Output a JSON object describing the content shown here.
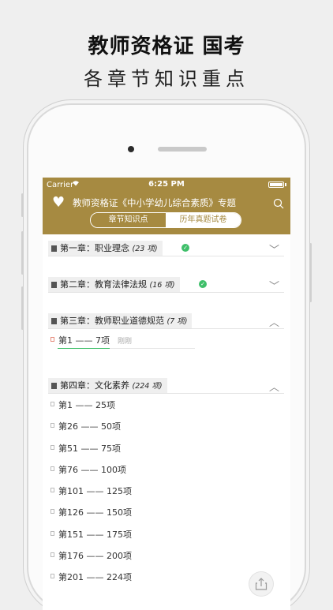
{
  "promo": {
    "title": "教师资格证 国考",
    "subtitle": "各章节知识重点"
  },
  "status": {
    "carrier": "Carrier",
    "time": "6:25 PM"
  },
  "header": {
    "title": "教师资格证《中小学幼儿综合素质》专题",
    "tabs": [
      {
        "label": "章节知识点",
        "active": true
      },
      {
        "label": "历年真题试卷",
        "active": false
      }
    ]
  },
  "chapters": [
    {
      "name": "第一章：职业理念",
      "count": "(23 项)",
      "completed": true,
      "expanded": false
    },
    {
      "name": "第二章：教育法律法规",
      "count": "(16 项)",
      "completed": true,
      "expanded": false
    },
    {
      "name": "第三章：教师职业道德规范",
      "count": "(7 项)",
      "completed": false,
      "expanded": true,
      "items": [
        {
          "label": "第1 —— 7项",
          "note": "刚刚",
          "progress": 0.38
        }
      ]
    },
    {
      "name": "第四章：文化素养",
      "count": "(224 项)",
      "completed": false,
      "expanded": true,
      "items": [
        {
          "label": "第1 —— 25项"
        },
        {
          "label": "第26 —— 50项"
        },
        {
          "label": "第51 —— 75项"
        },
        {
          "label": "第76 —— 100项"
        },
        {
          "label": "第101 —— 125项"
        },
        {
          "label": "第126 —— 150项"
        },
        {
          "label": "第151 —— 175项"
        },
        {
          "label": "第176 —— 200项"
        },
        {
          "label": "第201 —— 224项"
        }
      ]
    }
  ],
  "colors": {
    "accent": "#a68a41",
    "success": "#3fbf6a"
  },
  "icons": {
    "heart": "heart-icon",
    "search": "search-icon",
    "share": "share-icon",
    "check": "check-icon"
  }
}
